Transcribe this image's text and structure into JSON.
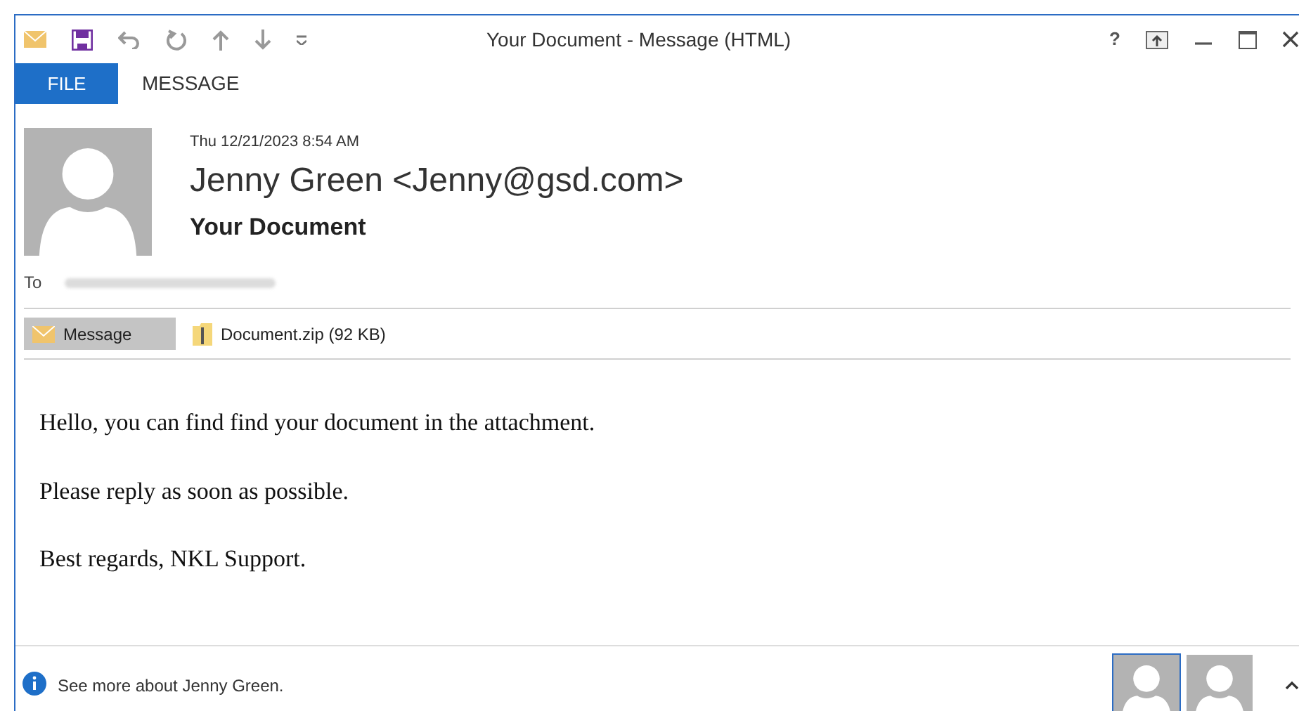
{
  "window": {
    "title": "Your Document - Message (HTML)",
    "help": "?"
  },
  "tabs": [
    {
      "label": "FILE",
      "selected": true
    },
    {
      "label": "MESSAGE",
      "selected": false
    }
  ],
  "header": {
    "date": "Thu 12/21/2023 8:54 AM",
    "sender": "Jenny Green <Jenny@gsd.com>",
    "subject": "Your Document",
    "to_label": "To"
  },
  "attachments": [
    {
      "kind": "message",
      "label": "Message",
      "selected": true
    },
    {
      "kind": "file",
      "label": "Document.zip (92 KB)",
      "selected": false
    }
  ],
  "body": [
    "Hello, you can find find your document in the attachment.",
    "Please reply as soon as possible.",
    "Best regards, NKL Support."
  ],
  "footer": {
    "text": "See more about Jenny Green.",
    "people": [
      {
        "selected": true
      },
      {
        "selected": false
      }
    ]
  }
}
